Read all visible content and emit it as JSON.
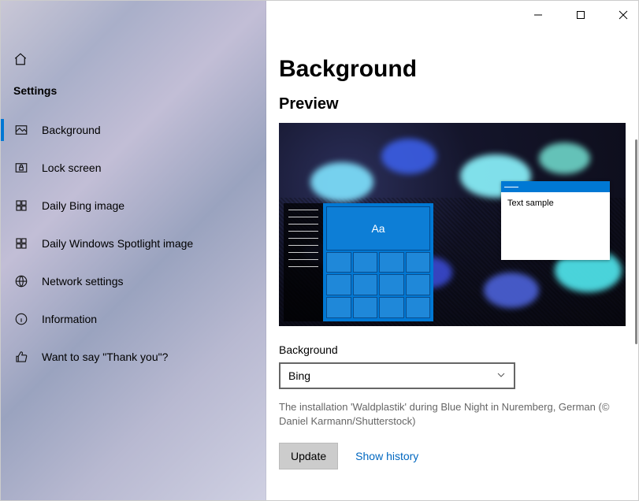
{
  "sidebar": {
    "header": "Settings",
    "items": [
      {
        "label": "Background",
        "icon": "picture-icon",
        "active": true
      },
      {
        "label": "Lock screen",
        "icon": "lock-icon",
        "active": false
      },
      {
        "label": "Daily Bing image",
        "icon": "grid-icon",
        "active": false
      },
      {
        "label": "Daily Windows Spotlight image",
        "icon": "grid-icon",
        "active": false
      },
      {
        "label": "Network settings",
        "icon": "globe-icon",
        "active": false
      },
      {
        "label": "Information",
        "icon": "info-icon",
        "active": false
      },
      {
        "label": "Want to say \"Thank you\"?",
        "icon": "thumbs-up-icon",
        "active": false
      }
    ]
  },
  "main": {
    "title": "Background",
    "preview_heading": "Preview",
    "preview_sample_text": "Text sample",
    "preview_tile_label": "Aa",
    "background_label": "Background",
    "background_selected": "Bing",
    "caption": "The installation 'Waldplastik' during Blue Night in Nuremberg, German (© Daniel Karmann/Shutterstock)",
    "update_button": "Update",
    "show_history_link": "Show history"
  },
  "colors": {
    "accent": "#0078d4",
    "link": "#0067c0"
  }
}
